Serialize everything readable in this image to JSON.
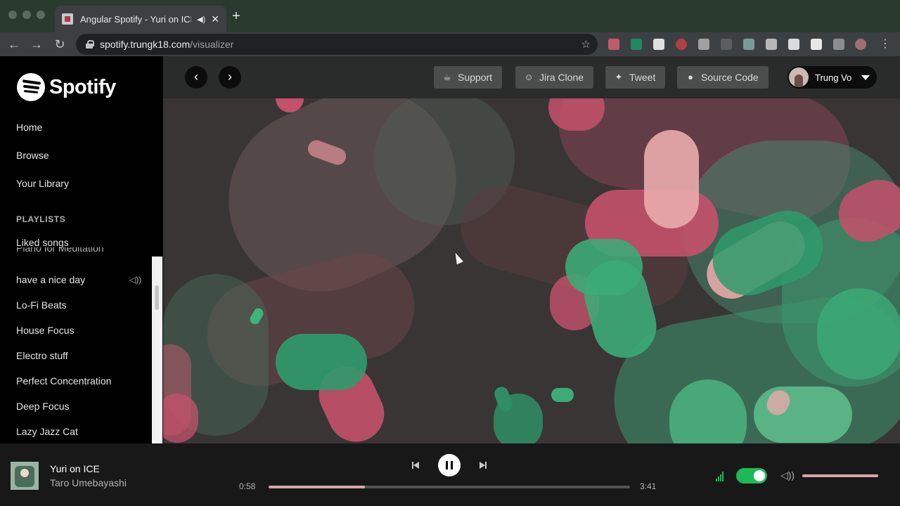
{
  "browser": {
    "tab_title": "Angular Spotify - Yuri on ICE",
    "tab_close": "✕",
    "new_tab": "+",
    "url_host": "spotify.trungk18.com",
    "url_path": "/visualizer",
    "back": "←",
    "forward": "→",
    "reload": "↻",
    "star": "☆",
    "audio_icon": "speaker-icon"
  },
  "sidebar": {
    "brand": "Spotify",
    "nav": [
      "Home",
      "Browse",
      "Your Library"
    ],
    "playlists_heading": "PLAYLISTS",
    "liked": "Liked songs",
    "clipped_item": "Piano for Meditation",
    "playlists": [
      "have a nice day",
      "Lo-Fi Beats",
      "House Focus",
      "Electro stuff",
      "Perfect Concentration",
      "Deep Focus",
      "Lazy Jazz Cat"
    ],
    "now_playing_icon": "speaker-icon"
  },
  "topbar": {
    "back_arrow": "‹",
    "forward_arrow": "›",
    "support": "Support",
    "jira": "Jira Clone",
    "tweet": "Tweet",
    "source": "Source Code",
    "user_name": "Trung Vo"
  },
  "player": {
    "title": "Yuri on ICE",
    "artist": "Taro Umebayashi",
    "elapsed": "0:58",
    "duration": "3:41",
    "progress": 0.267,
    "volume": 1.0,
    "visualizer_on": true
  },
  "colors": {
    "accent": "#1db954",
    "progress": "#d6a5a8",
    "viz_pink": "#c4516c",
    "viz_green": "#3c9d73"
  }
}
